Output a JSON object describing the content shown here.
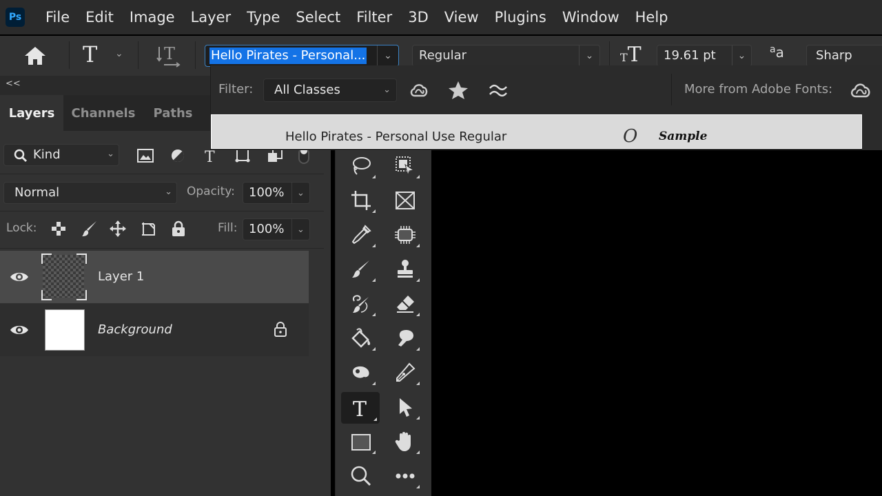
{
  "app": {
    "logo": "Ps",
    "menu": [
      "File",
      "Edit",
      "Image",
      "Layer",
      "Type",
      "Select",
      "Filter",
      "3D",
      "View",
      "Plugins",
      "Window",
      "Help"
    ]
  },
  "options_bar": {
    "font_family": "Hello Pirates - Personal...",
    "font_style": "Regular",
    "font_size": "19.61 pt",
    "antialias": "Sharp",
    "antialias_icon_text": "aₐ"
  },
  "font_dropdown": {
    "filter_label": "Filter:",
    "filter_class": "All Classes",
    "more_label": "More from Adobe Fonts:",
    "items": [
      {
        "name": "Hello Pirates - Personal Use Regular",
        "type_glyph": "O",
        "sample": "Sample"
      }
    ]
  },
  "panel": {
    "collapse_label": "<<",
    "tabs": [
      "Layers",
      "Channels",
      "Paths"
    ],
    "active_tab": "Layers",
    "kind_filter": "Kind",
    "blend_mode": "Normal",
    "opacity_label": "Opacity:",
    "opacity_value": "100%",
    "lock_label": "Lock:",
    "fill_label": "Fill:",
    "fill_value": "100%",
    "layers": [
      {
        "name": "Layer 1",
        "visible": true,
        "selected": true,
        "locked": false
      },
      {
        "name": "Background",
        "visible": true,
        "selected": false,
        "locked": true
      }
    ]
  },
  "toolbar": {
    "active_tool": "type-tool",
    "tools": [
      "lasso",
      "object-selection",
      "crop",
      "frame",
      "eyedropper",
      "spot-healing",
      "brush",
      "clone-stamp",
      "history-brush",
      "eraser",
      "paint-bucket",
      "smudge",
      "dodge",
      "pen",
      "type",
      "path-selection",
      "rectangle",
      "hand",
      "zoom",
      "more-tools"
    ]
  },
  "colors": {
    "accent": "#1473e6",
    "focus_border": "#3b82c4",
    "panel_bg": "#323232",
    "canvas_bg": "#000000"
  }
}
